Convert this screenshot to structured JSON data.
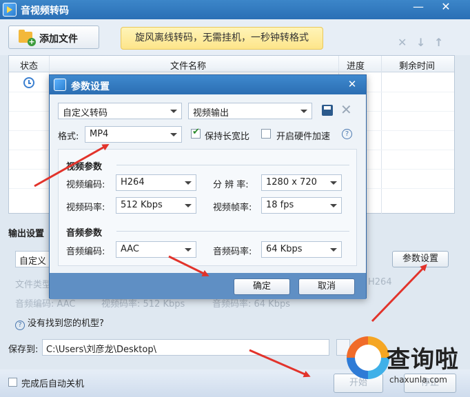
{
  "app": {
    "title": "音视频转码"
  },
  "toolbar": {
    "add_file_label": "添加文件",
    "promo": "旋风离线转码，无需挂机，一秒钟转格式"
  },
  "file_list": {
    "columns": [
      "状态",
      "文件名称",
      "进度",
      "剩余时间"
    ]
  },
  "output": {
    "section_label": "输出设置",
    "preset_value": "自定义",
    "param_button": "参数设置",
    "faded_file_type": "文件类型",
    "faded_h264": "H264",
    "faded_audio_codec": "音频编码: AAC",
    "faded_video_bitrate": "视频码率: 512 Kbps",
    "faded_audio_bitrate": "音频码率: 64 Kbps",
    "help_text": "没有找到您的机型?",
    "save_label": "保存到:",
    "save_path": "C:\\Users\\刘彦龙\\Desktop\\",
    "auto_shutdown": "完成后自动关机",
    "start_button": "开始",
    "stop_button": "停止"
  },
  "dialog": {
    "title": "参数设置",
    "preset_select": "自定义转码",
    "output_type_select": "视频输出",
    "format_label": "格式:",
    "format_value": "MP4",
    "keep_aspect_label": "保持长宽比",
    "keep_aspect_checked": true,
    "hw_accel_label": "开启硬件加速",
    "hw_accel_checked": false,
    "video_section": "视频参数",
    "video_codec_label": "视频编码:",
    "video_codec_value": "H264",
    "resolution_label": "分 辨 率:",
    "resolution_value": "1280 x 720",
    "video_bitrate_label": "视频码率:",
    "video_bitrate_value": "512 Kbps",
    "framerate_label": "视频帧率:",
    "framerate_value": "18 fps",
    "audio_section": "音频参数",
    "audio_codec_label": "音频编码:",
    "audio_codec_value": "AAC",
    "audio_bitrate_label": "音频码率:",
    "audio_bitrate_value": "64 Kbps",
    "ok_button": "确定",
    "cancel_button": "取消"
  },
  "watermark": {
    "name": "查询啦",
    "domain": "chaxunla.com"
  },
  "colors": {
    "title_blue": "#2a6fb5",
    "arrow_red": "#e2332b",
    "promo_yellow": "#fde58a"
  }
}
